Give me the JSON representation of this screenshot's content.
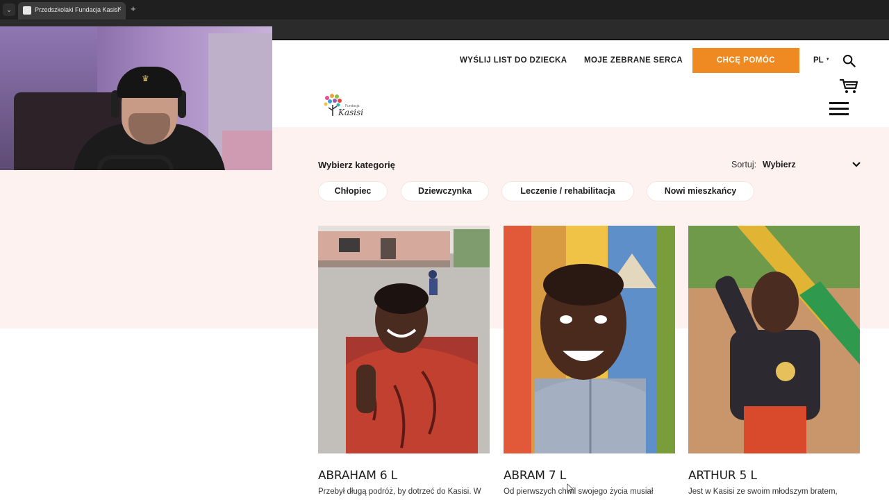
{
  "browser": {
    "tab_title": "Przedszkolaki Fundacja Kasisi",
    "tab_close": "×",
    "new_tab": "+"
  },
  "nav": {
    "links": [
      "WYŚLIJ LIST DO DZIECKA",
      "MOJE ZEBRANE SERCA"
    ],
    "cta": "CHCĘ POMÓC",
    "language": "PL"
  },
  "logo": {
    "small_text": "Fundacja",
    "name": "Kasisi"
  },
  "filters": {
    "title": "Wybierz kategorię",
    "sort_label": "Sortuj:",
    "sort_value": "Wybierz",
    "chips": [
      "Chłopiec",
      "Dziewczynka",
      "Leczenie / rehabilitacja",
      "Nowi mieszkańcy"
    ]
  },
  "cards": [
    {
      "name": "ABRAHAM 6 L",
      "desc": "Przebył długą podróż, by dotrzeć do Kasisi. W"
    },
    {
      "name": "ABRAM 7 L",
      "desc": "Od pierwszych chwil swojego życia musiał"
    },
    {
      "name": "ARTHUR 5 L",
      "desc": "Jest w Kasisi ze swoim młodszym bratem,"
    }
  ],
  "colors": {
    "accent": "#ef8a22",
    "band": "#fdf2f0",
    "text": "#1e1e1e"
  }
}
